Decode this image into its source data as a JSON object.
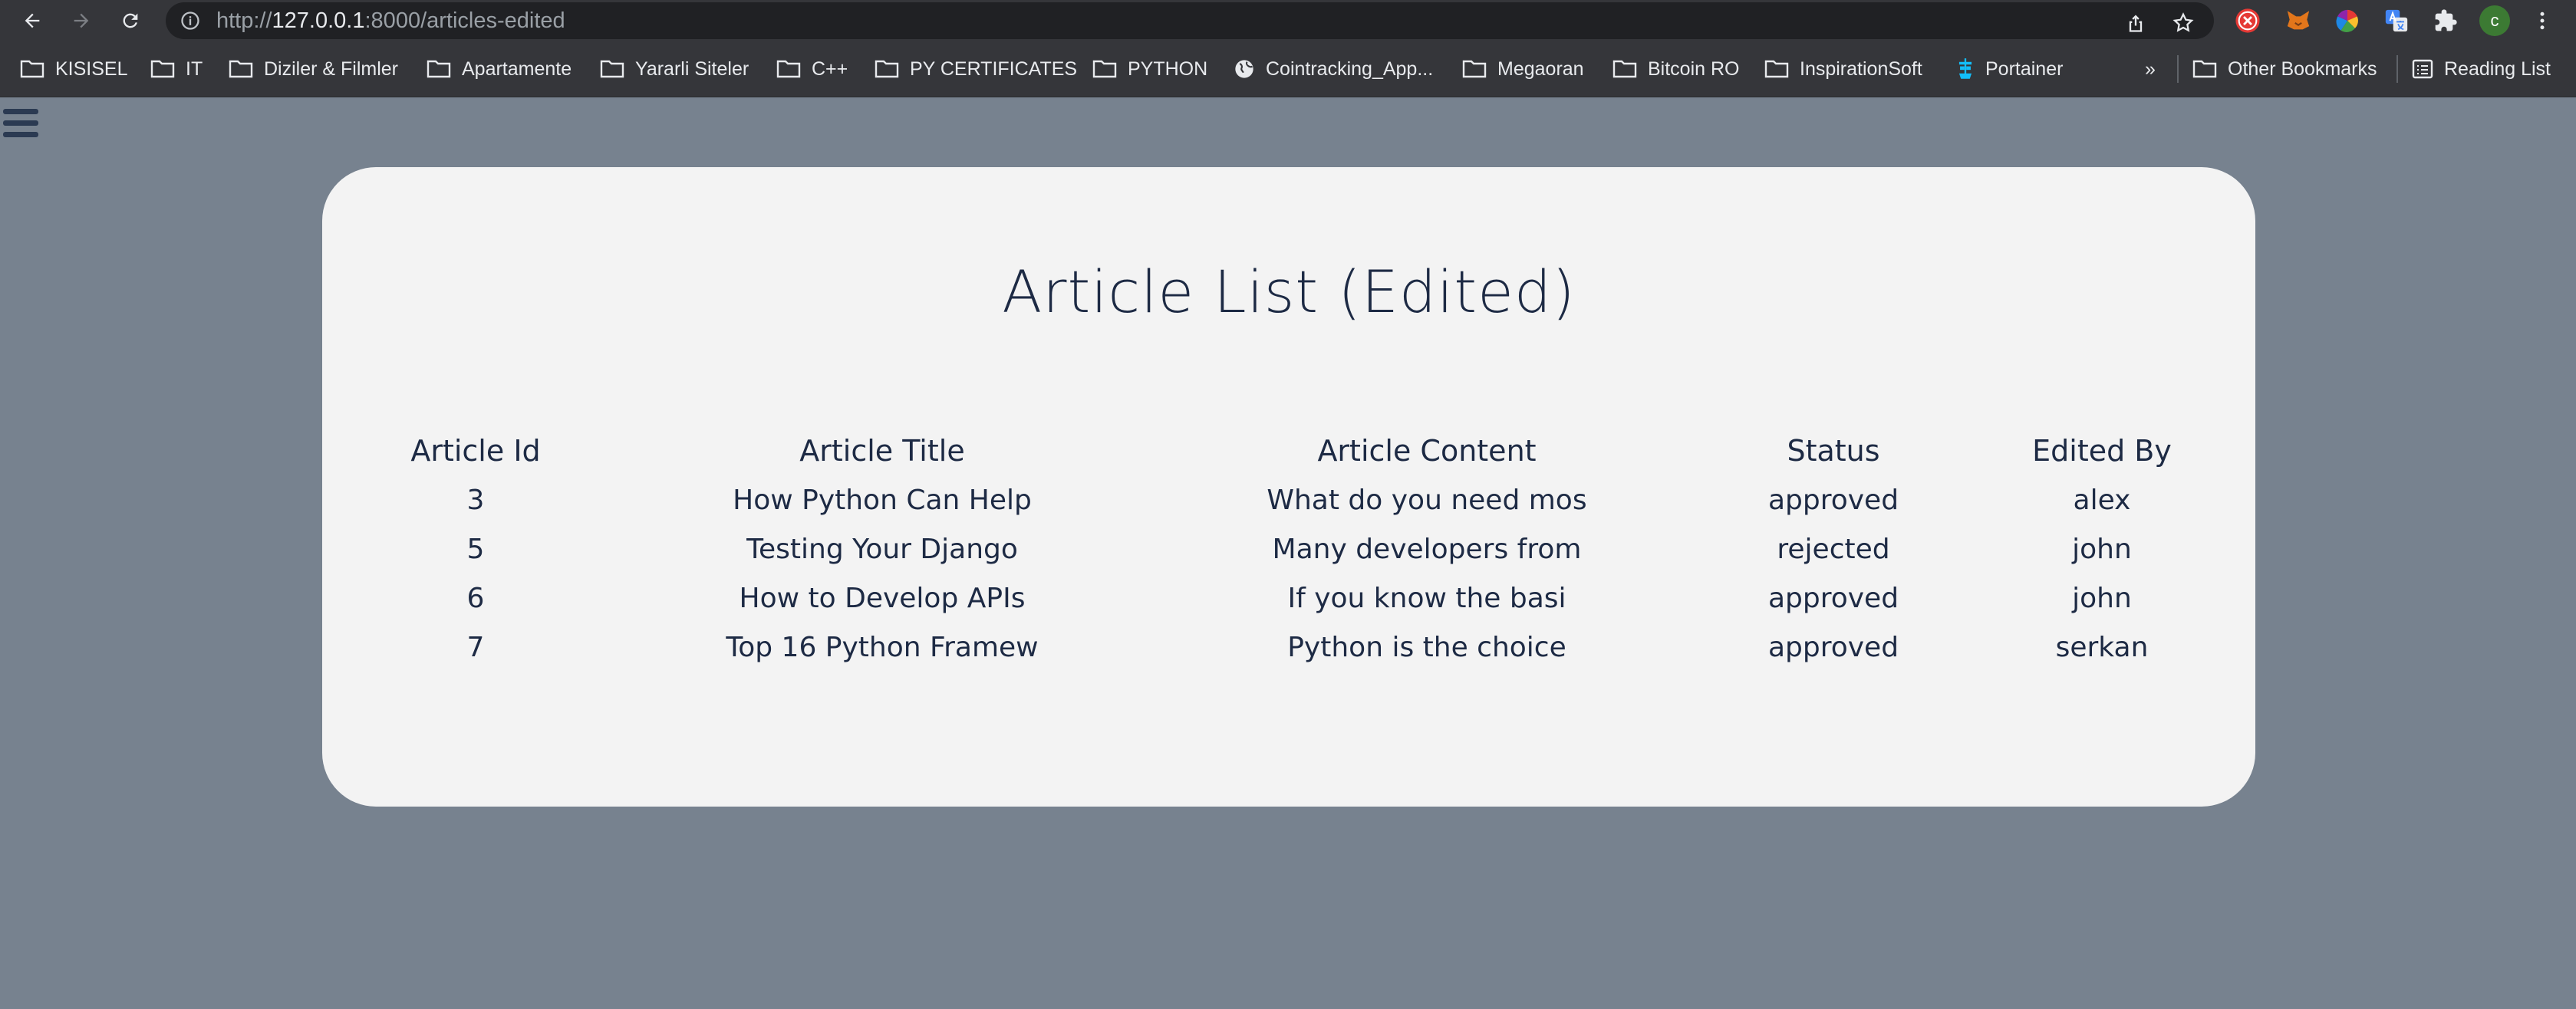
{
  "browser": {
    "url_prefix": "http://",
    "url_host": "127.0.0.1",
    "url_rest": ":8000/articles-edited",
    "avatar_letter": "c",
    "bookmarks": [
      {
        "label": "KISISEL",
        "icon": "folder-icon"
      },
      {
        "label": "IT",
        "icon": "folder-icon"
      },
      {
        "label": "Diziler & Filmler",
        "icon": "folder-icon"
      },
      {
        "label": "Apartamente",
        "icon": "folder-icon"
      },
      {
        "label": "Yararli Siteler",
        "icon": "folder-icon"
      },
      {
        "label": "C++",
        "icon": "folder-icon"
      },
      {
        "label": "PY CERTIFICATES",
        "icon": "folder-icon"
      },
      {
        "label": "PYTHON",
        "icon": "folder-icon"
      },
      {
        "label": "Cointracking_App...",
        "icon": "globe-icon"
      },
      {
        "label": "Megaoran",
        "icon": "folder-icon"
      },
      {
        "label": "Bitcoin RO",
        "icon": "folder-icon"
      },
      {
        "label": "InspirationSoft",
        "icon": "folder-icon"
      },
      {
        "label": "Portainer",
        "icon": "portainer-icon"
      }
    ],
    "overflow_label": "»",
    "other_bookmarks": "Other Bookmarks",
    "reading_list": "Reading List"
  },
  "page": {
    "title": "Article List (Edited)",
    "table": {
      "headers": [
        "Article Id",
        "Article Title",
        "Article Content",
        "Status",
        "Edited By"
      ],
      "rows": [
        [
          "3",
          "How Python Can Help",
          "What do you need mos",
          "approved",
          "alex"
        ],
        [
          "5",
          "Testing Your Django",
          "Many developers from",
          "rejected",
          "john"
        ],
        [
          "6",
          "How to Develop APIs",
          "If you know the basi",
          "approved",
          "john"
        ],
        [
          "7",
          "Top 16 Python Framew",
          "Python is the choice",
          "approved",
          "serkan"
        ]
      ]
    }
  }
}
